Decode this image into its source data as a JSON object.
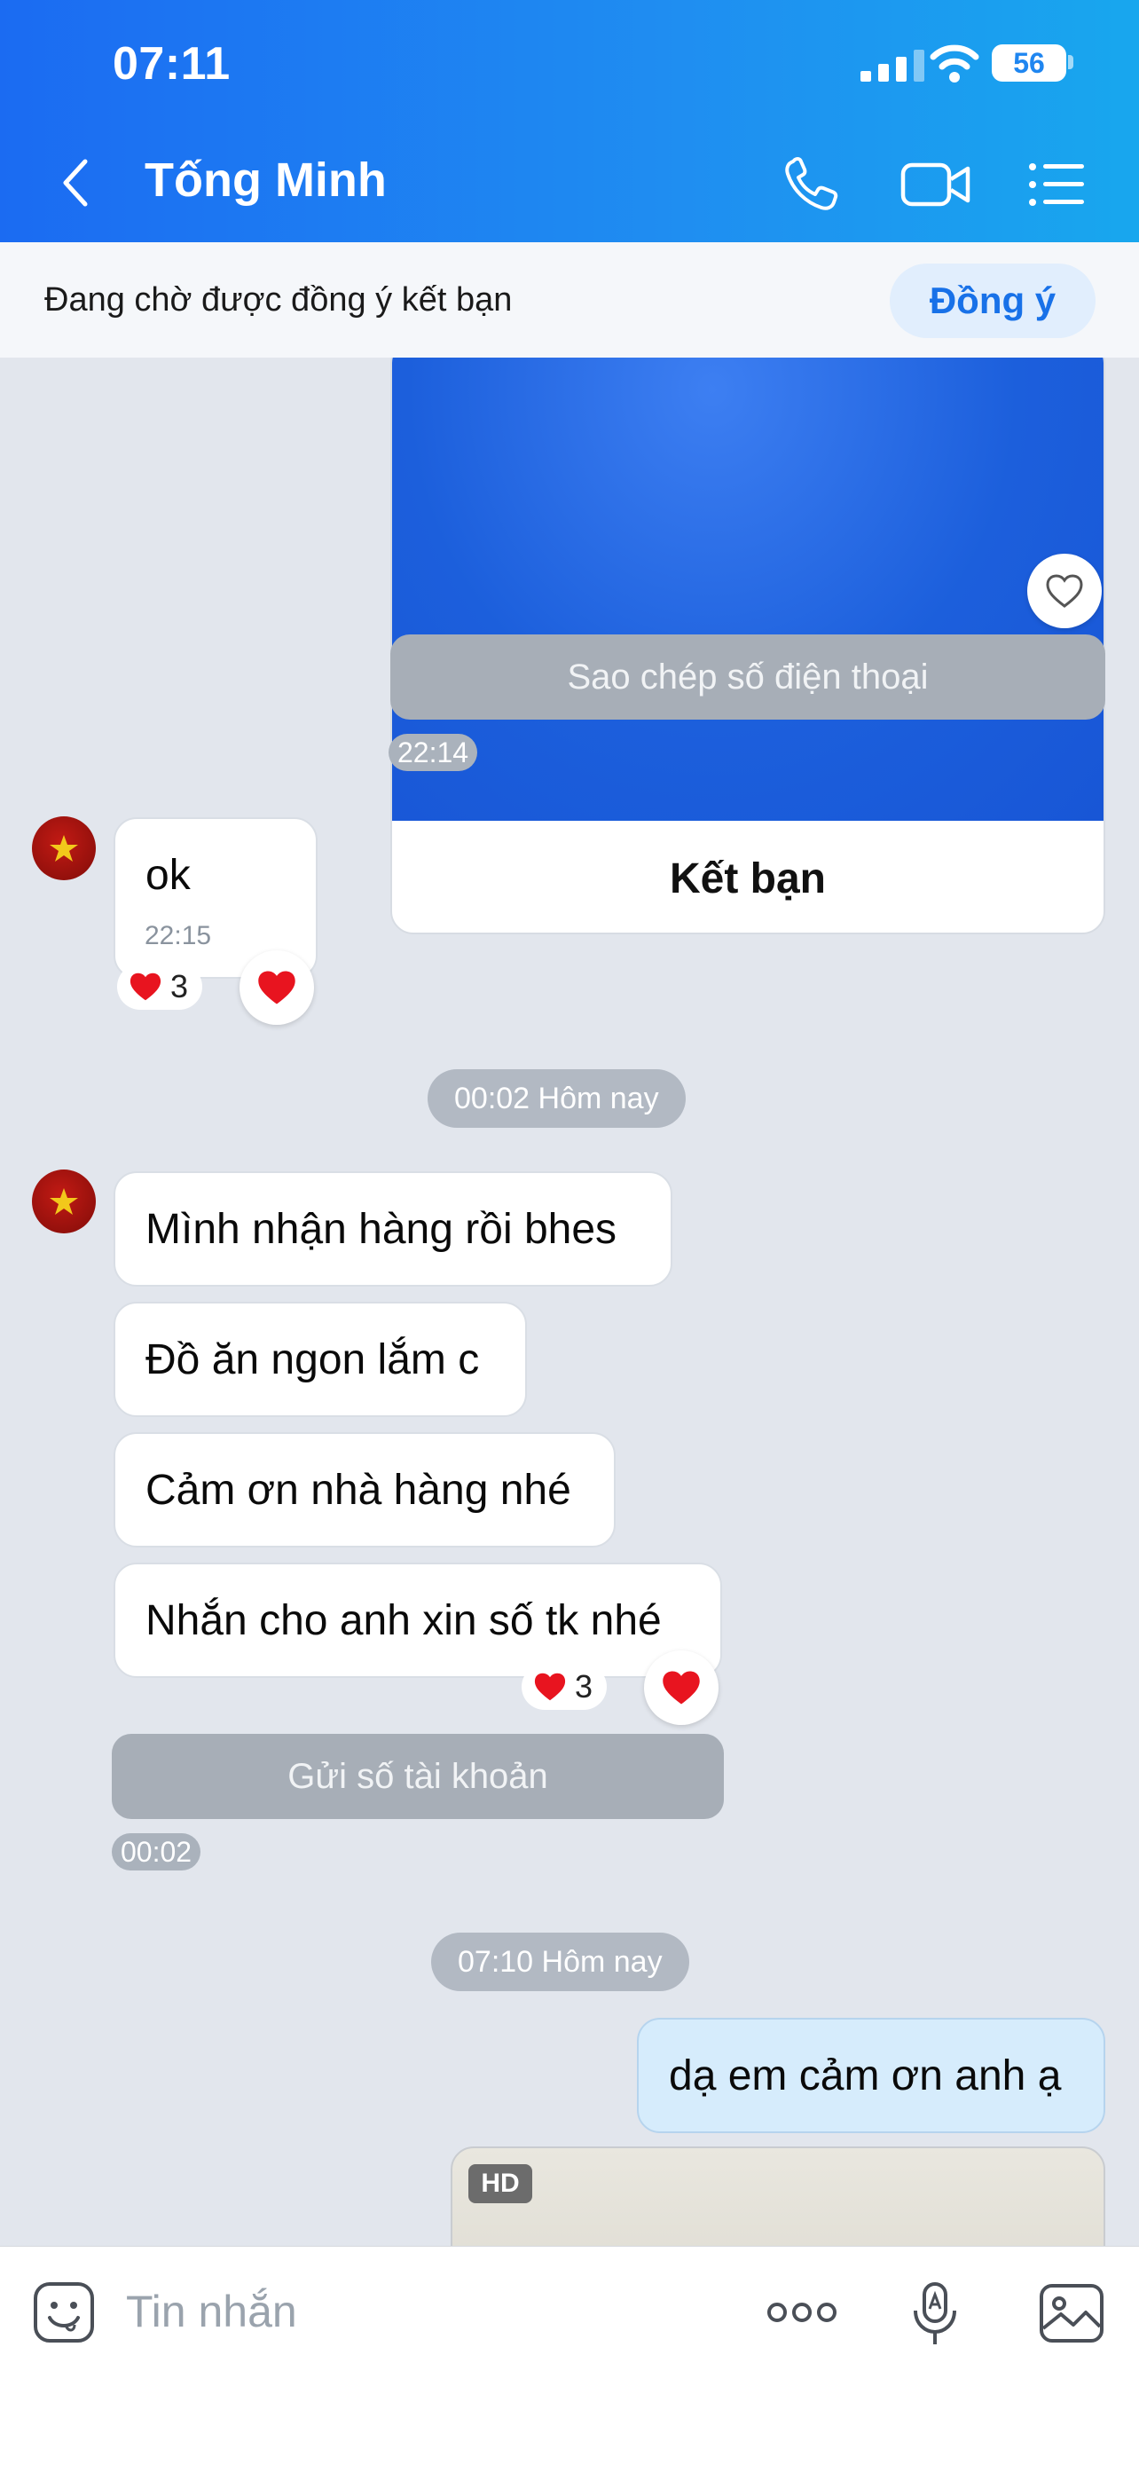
{
  "status_bar": {
    "time": "07:11",
    "battery": "56"
  },
  "header": {
    "contact_name": "Tống Minh"
  },
  "friend_request": {
    "text": "Đang chờ được đồng ý kết bạn",
    "accept_label": "Đồng ý"
  },
  "card": {
    "label": "Kết bạn"
  },
  "copy_phone_label": "Sao chép số điện thoại",
  "time_1": "22:14",
  "msg_ok": {
    "text": "ok",
    "time": "22:15",
    "reaction_count": "3"
  },
  "date_1": "00:02 Hôm nay",
  "messages_in": [
    "Mình nhận hàng rồi bhes",
    "Đồ ăn ngon lắm c",
    "Cảm ơn nhà hàng nhé",
    "Nhắn cho anh xin số tk nhé"
  ],
  "reaction_count_2": "3",
  "send_account_label": "Gửi số tài khoản",
  "time_2": "00:02",
  "date_2": "07:10 Hôm nay",
  "message_out": "dạ em cảm ơn anh ạ",
  "photo_badge": "HD",
  "input": {
    "placeholder": "Tin nhắn"
  }
}
